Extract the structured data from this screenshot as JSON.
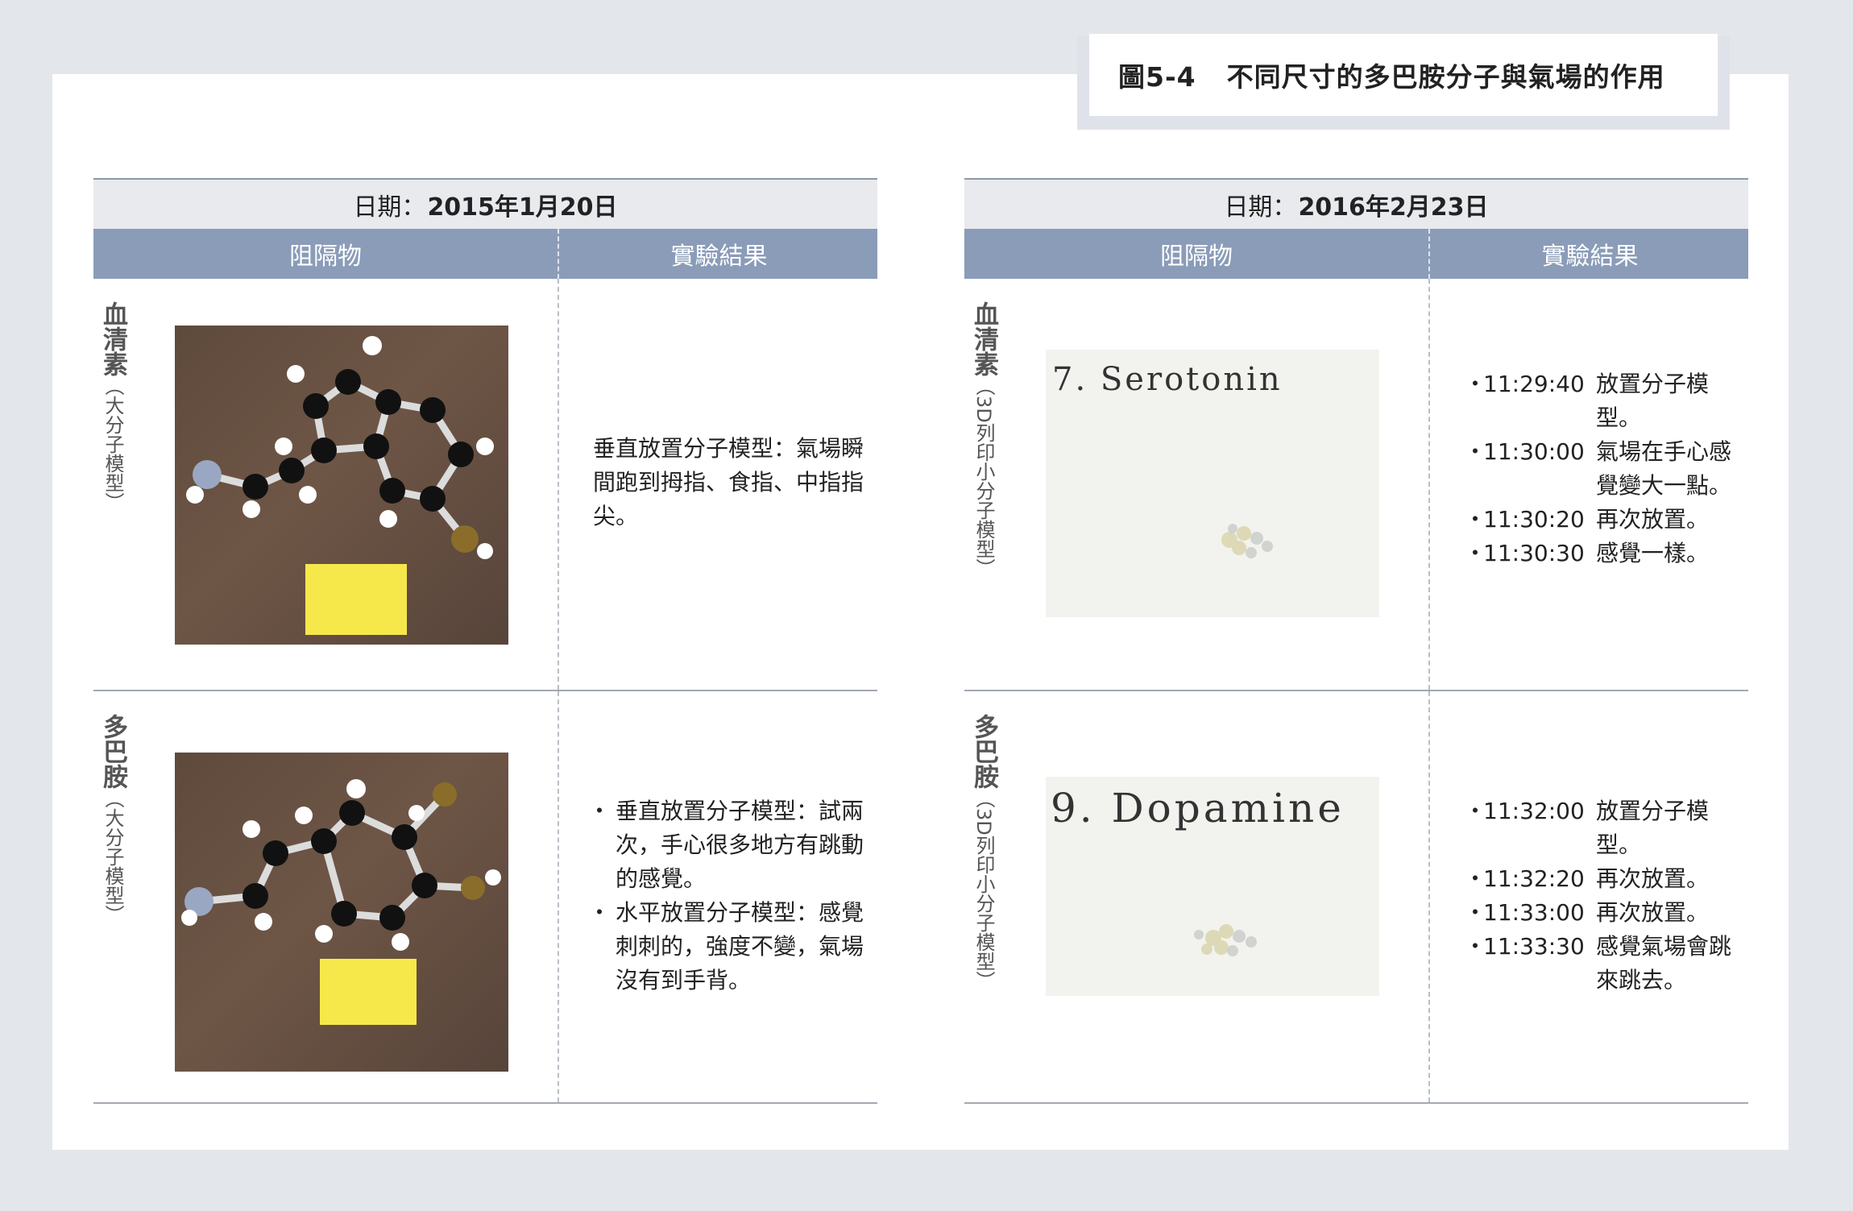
{
  "figure": {
    "number": "圖5-4",
    "title": "不同尺寸的多巴胺分子與氣場的作用"
  },
  "tables": [
    {
      "date_label": "日期：",
      "date_value": "2015年1月20日",
      "col_barrier": "阻隔物",
      "col_result": "實驗結果",
      "rows": [
        {
          "label_main": "血清素",
          "label_sub": "（大分子模型）",
          "photo_desc": "ball-and-stick molecular model on wood",
          "result_text": "垂直放置分子模型：氣場瞬間跑到拇指、食指、中指指尖。"
        },
        {
          "label_main": "多巴胺",
          "label_sub": "（大分子模型）",
          "photo_desc": "ball-and-stick molecular model on wood",
          "result_items": [
            "垂直放置分子模型：試兩次，手心很多地方有跳動的感覺。",
            "水平放置分子模型：感覺刺刺的，強度不變，氣場沒有到手背。"
          ]
        }
      ]
    },
    {
      "date_label": "日期：",
      "date_value": "2016年2月23日",
      "col_barrier": "阻隔物",
      "col_result": "實驗結果",
      "rows": [
        {
          "label_main": "血清素",
          "label_sub": "（3D列印小分子模型）",
          "photo_caption": "7. Serotonin",
          "time_items": [
            {
              "time": "11:29:40",
              "text": "放置分子模型。"
            },
            {
              "time": "11:30:00",
              "text": "氣場在手心感覺變大一點。"
            },
            {
              "time": "11:30:20",
              "text": "再次放置。"
            },
            {
              "time": "11:30:30",
              "text": "感覺一樣。"
            }
          ]
        },
        {
          "label_main": "多巴胺",
          "label_sub": "（3D列印小分子模型）",
          "photo_caption": "9. Dopamine",
          "time_items": [
            {
              "time": "11:32:00",
              "text": "放置分子模型。"
            },
            {
              "time": "11:32:20",
              "text": "再次放置。"
            },
            {
              "time": "11:33:00",
              "text": "再次放置。"
            },
            {
              "time": "11:33:30",
              "text": "感覺氣場會跳來跳去。"
            }
          ]
        }
      ]
    }
  ],
  "colors": {
    "header_band": "#8a9cb8",
    "date_band": "#e8eaee",
    "background": "#e3e6eb",
    "sticky_note": "#f6e84a"
  }
}
